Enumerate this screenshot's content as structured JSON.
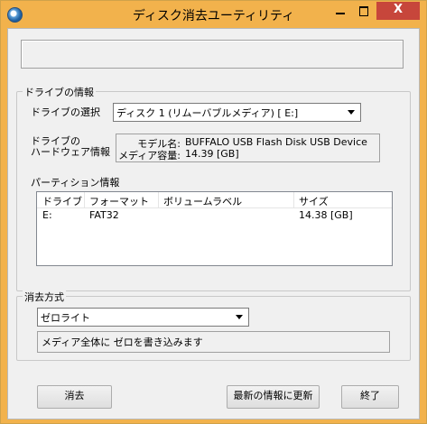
{
  "window": {
    "title": "ディスク消去ユーティリティ",
    "close_glyph": "X"
  },
  "drive_group": {
    "title": "ドライブの情報",
    "select_label": "ドライブの選択",
    "selected_drive": "ディスク 1 (リムーバブルメディア) [ E:]",
    "hw_label_line1": "ドライブの",
    "hw_label_line2": "ハードウェア情報",
    "model_key": "モデル名:",
    "model_value": "BUFFALO USB Flash Disk USB Device",
    "capacity_key": "メディア容量:",
    "capacity_value": "14.39 [GB]",
    "partition_label": "パーティション情報",
    "columns": [
      "ドライブ",
      "フォーマット",
      "ボリュームラベル",
      "サイズ"
    ],
    "rows": [
      {
        "drive": "E:",
        "format": "FAT32",
        "label": "",
        "size": "14.38 [GB]"
      }
    ]
  },
  "erase_group": {
    "title": "消去方式",
    "method": "ゼロライト",
    "description": "メディア全体に ゼロを書き込みます"
  },
  "buttons": {
    "erase": "消去",
    "refresh": "最新の情報に更新",
    "exit": "終了"
  }
}
